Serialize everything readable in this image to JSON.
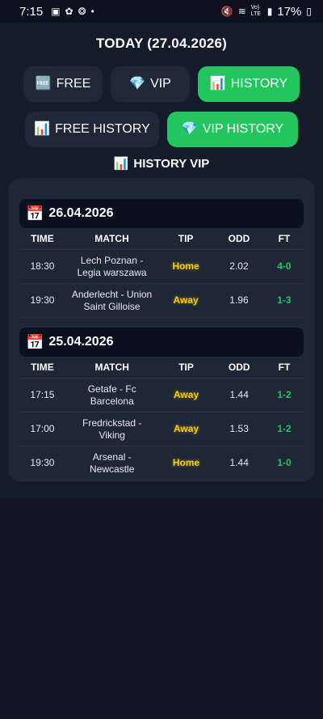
{
  "status_bar": {
    "time": "7:15",
    "battery": "17%",
    "network": "Vo) LTE"
  },
  "header": {
    "today": "TODAY (27.04.2026)"
  },
  "tabs_row1": [
    {
      "emoji": "🆓",
      "label": "FREE"
    },
    {
      "emoji": "💎",
      "label": "VIP"
    },
    {
      "emoji": "📊",
      "label": "HISTORY"
    }
  ],
  "tabs_row2": [
    {
      "emoji": "📊",
      "label": "FREE HISTORY"
    },
    {
      "emoji": "💎",
      "label": "VIP HISTORY"
    }
  ],
  "section_title": {
    "emoji": "📊",
    "label": "HISTORY VIP"
  },
  "columns": [
    "TIME",
    "MATCH",
    "TIP",
    "ODD",
    "FT"
  ],
  "groups": [
    {
      "date": "26.04.2026",
      "rows": [
        {
          "time": "18:30",
          "match_line1": "Lech Poznan -",
          "match_line2": "Legia warszawa",
          "tip": "Home",
          "odd": "2.02",
          "ft": "4-0"
        },
        {
          "time": "19:30",
          "match_line1": "Anderlecht - Union",
          "match_line2": "Saint Gilloise",
          "tip": "Away",
          "odd": "1.96",
          "ft": "1-3"
        }
      ]
    },
    {
      "date": "25.04.2026",
      "rows": [
        {
          "time": "17:15",
          "match_line1": "Getafe - Fc",
          "match_line2": "Barcelona",
          "tip": "Away",
          "odd": "1.44",
          "ft": "1-2"
        },
        {
          "time": "17:00",
          "match_line1": "Fredrickstad -",
          "match_line2": "Viking",
          "tip": "Away",
          "odd": "1.53",
          "ft": "1-2"
        },
        {
          "time": "19:30",
          "match_line1": "Arsenal -",
          "match_line2": "Newcastle",
          "tip": "Home",
          "odd": "1.44",
          "ft": "1-0"
        }
      ]
    }
  ],
  "colors": {
    "accent_green": "#22c55e",
    "tip_yellow": "#facc15",
    "card_bg": "#1f2737",
    "page_bg": "#0f1524"
  }
}
